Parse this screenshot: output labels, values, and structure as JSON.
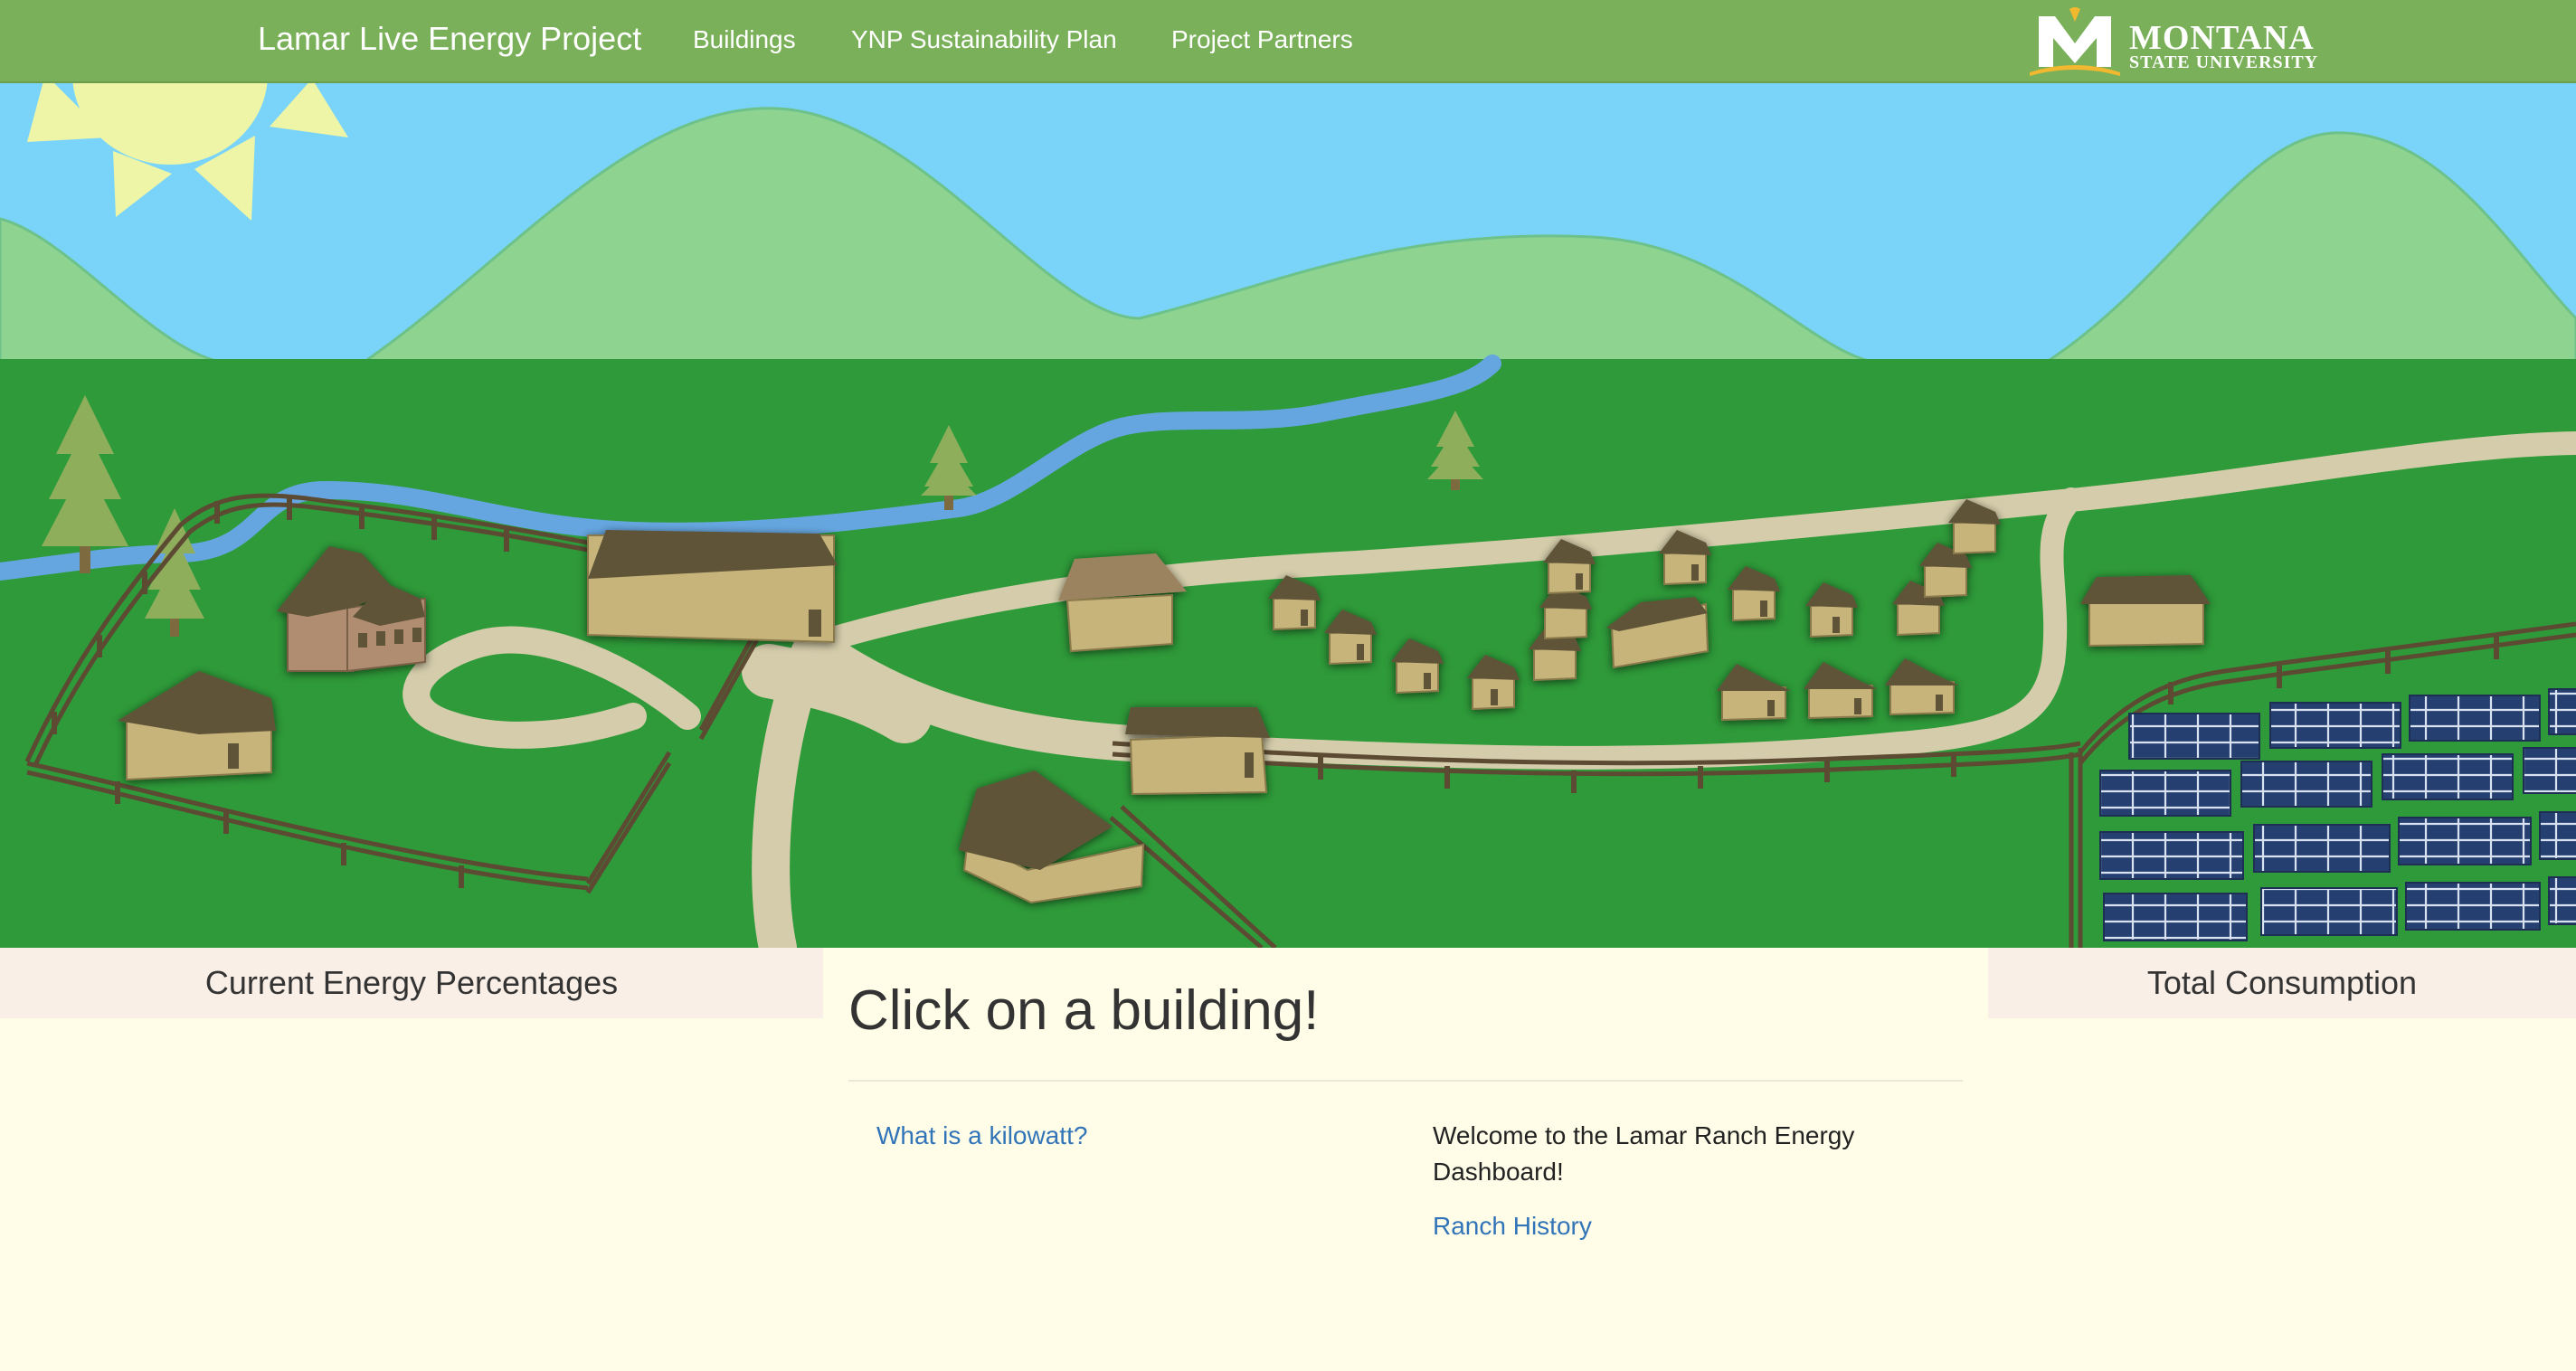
{
  "nav": {
    "brand": "Lamar Live Energy Project",
    "items": [
      "Buildings",
      "YNP Sustainability Plan",
      "Project Partners"
    ],
    "logo_primary": "MONTANA",
    "logo_secondary": "STATE UNIVERSITY"
  },
  "panels": {
    "left_title": "Current Energy Percentages",
    "right_title": "Total Consumption"
  },
  "main": {
    "title": "Click on a building!",
    "kilowatt_link": "What is a kilowatt?",
    "welcome_text": "Welcome to the Lamar Ranch Energy Dashboard!",
    "history_link": "Ranch History"
  },
  "colors": {
    "nav_bg": "#7ab05a",
    "sky": "#7ad4fa",
    "hills": "#8fd390",
    "grass": "#2e9a39",
    "link": "#3274b8",
    "page_bg": "#fffde8",
    "panel_head_bg": "#f9efe6"
  },
  "icons": {
    "logo": "montana-state-m-logo",
    "sun": "sun-icon"
  }
}
